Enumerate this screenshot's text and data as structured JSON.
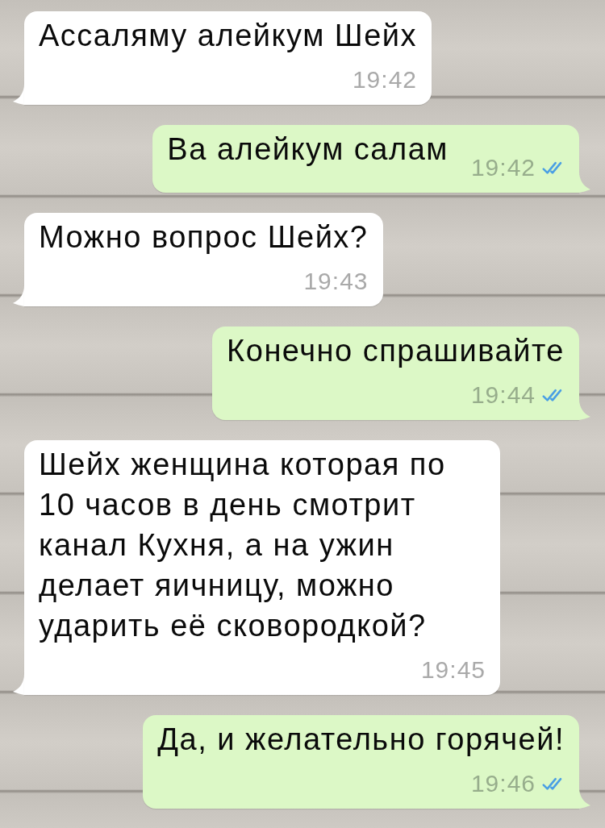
{
  "messages": [
    {
      "kind": "incoming",
      "text": "Ассаляму алейкум Шейх",
      "time": "19:42"
    },
    {
      "kind": "outgoing",
      "text": "Ва алейкум салам",
      "time": "19:42",
      "read": true
    },
    {
      "kind": "incoming",
      "text": "Можно вопрос Шейх?",
      "time": "19:43"
    },
    {
      "kind": "outgoing",
      "text": "Конечно спрашивайте",
      "time": "19:44",
      "read": true
    },
    {
      "kind": "incoming",
      "text": "Шейх женщина которая по 10 часов в день смотрит канал Кухня, а на ужин делает яичницу, можно ударить её сковородкой?",
      "time": "19:45"
    },
    {
      "kind": "outgoing",
      "text": "Да, и желательно горячей!",
      "time": "19:46",
      "read": true
    }
  ]
}
